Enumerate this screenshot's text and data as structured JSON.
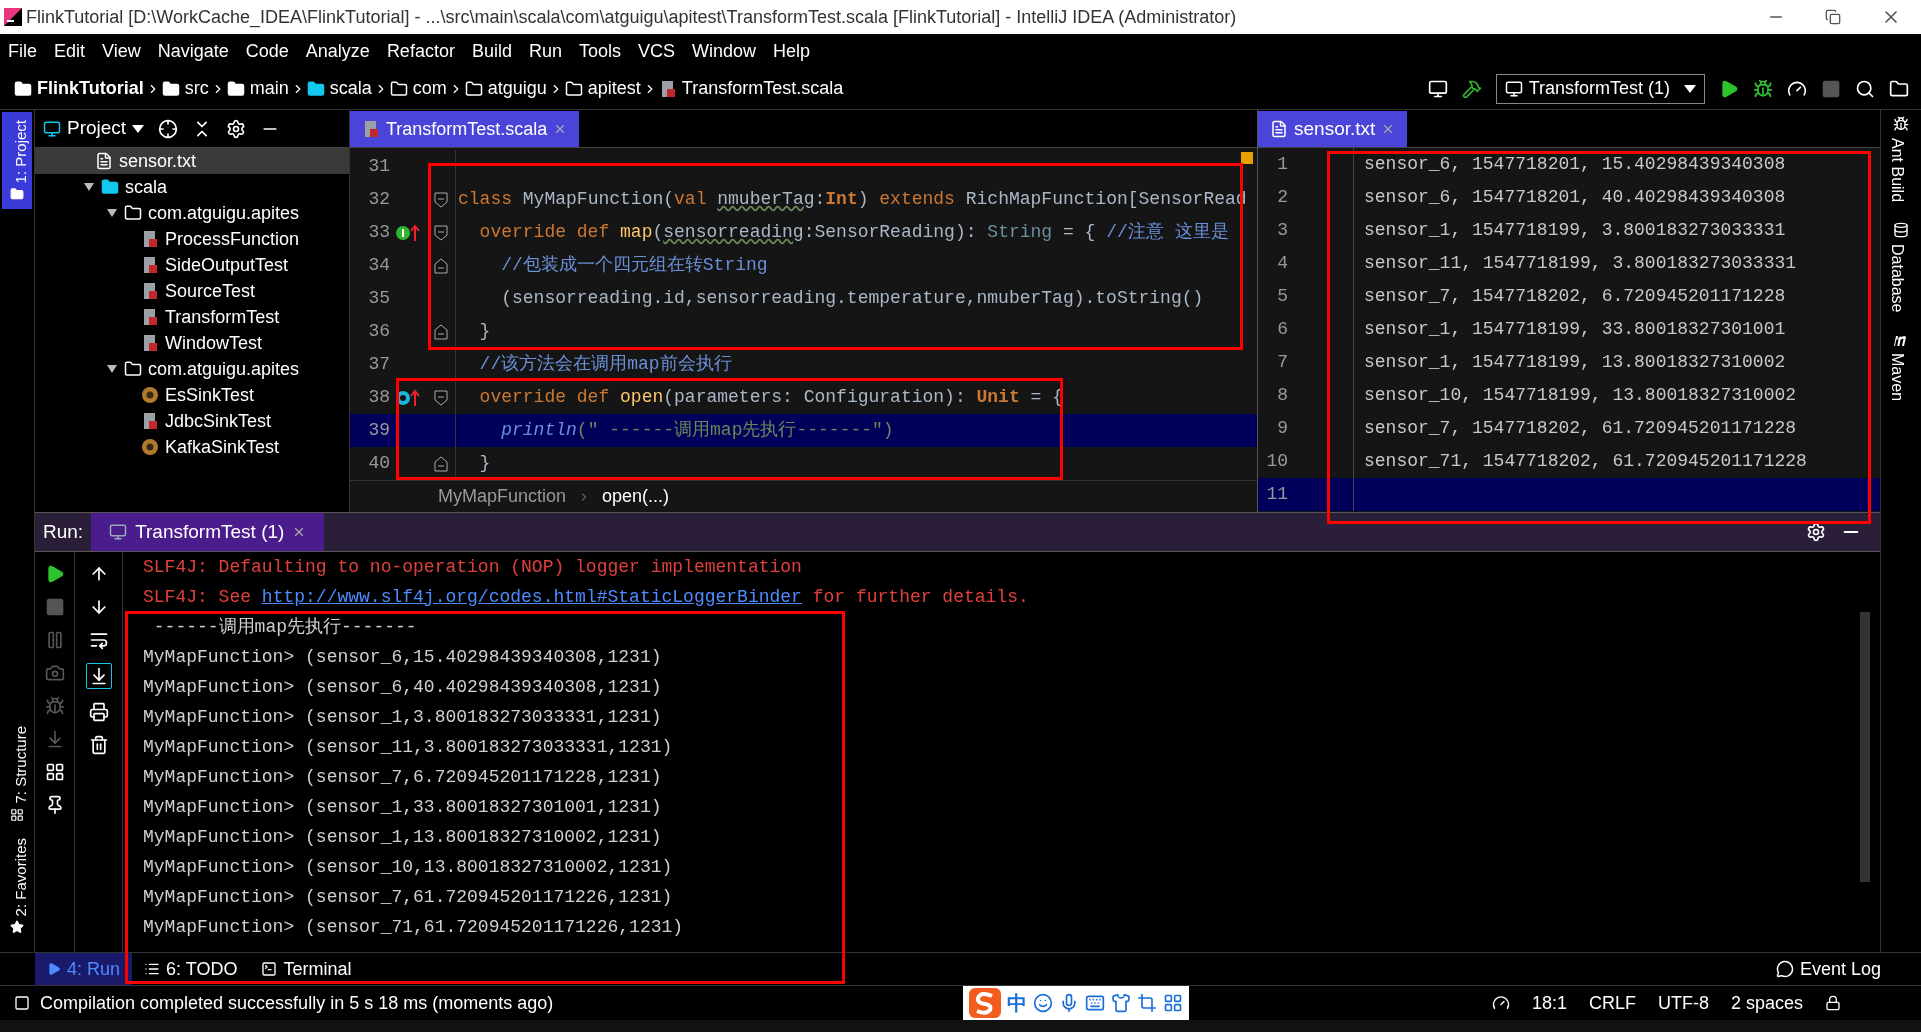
{
  "window": {
    "title": "FlinkTutorial [D:\\WorkCache_IDEA\\FlinkTutorial] - ...\\src\\main\\scala\\com\\atguigu\\apitest\\TransformTest.scala [FlinkTutorial] - IntelliJ IDEA (Administrator)"
  },
  "menu": [
    "File",
    "Edit",
    "View",
    "Navigate",
    "Code",
    "Analyze",
    "Refactor",
    "Build",
    "Run",
    "Tools",
    "VCS",
    "Window",
    "Help"
  ],
  "breadcrumb": [
    {
      "label": "FlinkTutorial",
      "kind": "project"
    },
    {
      "label": "src",
      "kind": "folder"
    },
    {
      "label": "main",
      "kind": "folder"
    },
    {
      "label": "scala",
      "kind": "source"
    },
    {
      "label": "com",
      "kind": "package"
    },
    {
      "label": "atguigu",
      "kind": "package"
    },
    {
      "label": "apitest",
      "kind": "package"
    },
    {
      "label": "TransformTest.scala",
      "kind": "file"
    }
  ],
  "run_config": "TransformTest (1)",
  "left_strip_top": [
    {
      "label": "1: Project",
      "selected": true
    }
  ],
  "left_strip_bottom": [
    {
      "label": "7: Structure",
      "selected": false
    },
    {
      "label": "2: Favorites",
      "selected": false
    }
  ],
  "right_strip": [
    {
      "label": "Ant Build",
      "kind": "ant"
    },
    {
      "label": "Database",
      "kind": "database"
    },
    {
      "label": "Maven",
      "kind": "maven"
    }
  ],
  "project_panel": {
    "title": "Project",
    "tree": [
      {
        "label": "sensor.txt",
        "kind": "text",
        "selected": true
      },
      {
        "label": "scala",
        "kind": "source",
        "selected": false,
        "expanded": true,
        "children": [
          {
            "label": "com.atguigu.apites",
            "kind": "package",
            "selected": false,
            "expanded": true,
            "children": [
              {
                "label": "ProcessFunction",
                "kind": "scala",
                "selected": false
              },
              {
                "label": "SideOutputTest",
                "kind": "scala",
                "selected": false
              },
              {
                "label": "SourceTest",
                "kind": "scala",
                "selected": false
              },
              {
                "label": "TransformTest",
                "kind": "scala",
                "selected": false
              },
              {
                "label": "WindowTest",
                "kind": "scala",
                "selected": false
              }
            ]
          },
          {
            "label": "com.atguigu.apites",
            "kind": "package",
            "selected": false,
            "expanded": true,
            "children": [
              {
                "label": "EsSinkTest",
                "kind": "object",
                "selected": false
              },
              {
                "label": "JdbcSinkTest",
                "kind": "scala",
                "selected": false
              },
              {
                "label": "KafkaSinkTest",
                "kind": "object",
                "selected": false
              }
            ]
          }
        ]
      }
    ]
  },
  "editor": {
    "tab": {
      "label": "TransformTest.scala",
      "selected": true
    },
    "lines": [
      {
        "number": "31",
        "selected": false
      },
      {
        "number": "32",
        "selected": false,
        "fold": {
          "kind": "start"
        },
        "tokens": [
          {
            "text": "class",
            "kind": "keyword"
          },
          {
            "text": " MyMapFunction(",
            "kind": "plain"
          },
          {
            "text": "val ",
            "kind": "keyword"
          },
          {
            "text": "nmuberTag",
            "kind": "underlined"
          },
          {
            "text": ":",
            "kind": "plain"
          },
          {
            "text": "Int",
            "kind": "bold_keyword"
          },
          {
            "text": ") ",
            "kind": "plain"
          },
          {
            "text": "extends",
            "kind": "keyword"
          },
          {
            "text": " RichMapFunction[SensorRead",
            "kind": "plain"
          }
        ]
      },
      {
        "number": "33",
        "selected": false,
        "fold": {
          "kind": "start"
        },
        "marker": {
          "kind": "implements"
        },
        "tokens": [
          {
            "text": "  override def ",
            "kind": "keyword"
          },
          {
            "text": "map",
            "kind": "function"
          },
          {
            "text": "(",
            "kind": "plain"
          },
          {
            "text": "sensorreading",
            "kind": "underlined"
          },
          {
            "text": ":SensorReading): ",
            "kind": "plain"
          },
          {
            "text": "String",
            "kind": "type"
          },
          {
            "text": " = { ",
            "kind": "plain"
          },
          {
            "text": "//注意 这里是",
            "kind": "comment"
          }
        ]
      },
      {
        "number": "34",
        "selected": false,
        "fold": {
          "kind": "end"
        },
        "tokens": [
          {
            "text": "    //包装成一个四元组在转String",
            "kind": "comment"
          }
        ]
      },
      {
        "number": "35",
        "selected": false,
        "tokens": [
          {
            "text": "    (sensorreading.id,sensorreading.temperature,nmuberTag).toString()",
            "kind": "plain"
          }
        ]
      },
      {
        "number": "36",
        "selected": false,
        "fold": {
          "kind": "end"
        },
        "tokens": [
          {
            "text": "  }",
            "kind": "plain"
          }
        ]
      },
      {
        "number": "37",
        "selected": false,
        "tokens": [
          {
            "text": "  //该方法会在调用map前会执行",
            "kind": "comment"
          }
        ]
      },
      {
        "number": "38",
        "selected": false,
        "fold": {
          "kind": "start"
        },
        "marker": {
          "kind": "overridden"
        },
        "tokens": [
          {
            "text": "  override def ",
            "kind": "keyword"
          },
          {
            "text": "open",
            "kind": "function"
          },
          {
            "text": "(parameters: Configuration): ",
            "kind": "plain"
          },
          {
            "text": "Unit",
            "kind": "bold_keyword"
          },
          {
            "text": " = {",
            "kind": "plain"
          }
        ]
      },
      {
        "number": "39",
        "selected": true,
        "tokens": [
          {
            "text": "    println",
            "kind": "italic"
          },
          {
            "text": "(\" ------调用map先执行-------\")",
            "kind": "string"
          }
        ]
      },
      {
        "number": "40",
        "selected": false,
        "fold": {
          "kind": "end"
        },
        "tokens": [
          {
            "text": "  }",
            "kind": "plain"
          }
        ]
      }
    ],
    "breadcrumbs": [
      "MyMapFunction",
      "open(...)"
    ]
  },
  "sensor_editor": {
    "tab": {
      "label": "sensor.txt",
      "selected": true
    },
    "lines": [
      {
        "number": "1",
        "text": "sensor_6, 1547718201, 15.40298439340308",
        "selected": false
      },
      {
        "number": "2",
        "text": "sensor_6, 1547718201, 40.40298439340308",
        "selected": false
      },
      {
        "number": "3",
        "text": "sensor_1, 1547718199, 3.800183273033331",
        "selected": false
      },
      {
        "number": "4",
        "text": "sensor_11, 1547718199, 3.800183273033331",
        "selected": false
      },
      {
        "number": "5",
        "text": "sensor_7, 1547718202, 6.720945201171228",
        "selected": false
      },
      {
        "number": "6",
        "text": "sensor_1, 1547718199, 33.80018327301001",
        "selected": false
      },
      {
        "number": "7",
        "text": "sensor_1, 1547718199, 13.80018327310002",
        "selected": false
      },
      {
        "number": "8",
        "text": "sensor_10, 1547718199, 13.80018327310002",
        "selected": false
      },
      {
        "number": "9",
        "text": "sensor_7, 1547718202, 61.720945201171228",
        "selected": false
      },
      {
        "number": "10",
        "text": "sensor_71, 1547718202, 61.720945201171228",
        "selected": false
      },
      {
        "number": "11",
        "selected": true
      }
    ]
  },
  "run": {
    "label": "Run:",
    "tab": {
      "label": "TransformTest (1)",
      "selected": true
    },
    "console": [
      {
        "kind": "error",
        "text": "SLF4J: Defaulting to no-operation (NOP) logger implementation"
      },
      {
        "kind": "error",
        "text": "SLF4J: See ",
        "link": "http://www.slf4j.org/codes.html#StaticLoggerBinder",
        "after": " for further details."
      },
      {
        "kind": "output",
        "text": " ------调用map先执行-------"
      },
      {
        "kind": "output",
        "text": "MyMapFunction> (sensor_6,15.40298439340308,1231)"
      },
      {
        "kind": "output",
        "text": "MyMapFunction> (sensor_6,40.40298439340308,1231)"
      },
      {
        "kind": "output",
        "text": "MyMapFunction> (sensor_1,3.800183273033331,1231)"
      },
      {
        "kind": "output",
        "text": "MyMapFunction> (sensor_11,3.800183273033331,1231)"
      },
      {
        "kind": "output",
        "text": "MyMapFunction> (sensor_7,6.720945201171228,1231)"
      },
      {
        "kind": "output",
        "text": "MyMapFunction> (sensor_1,33.80018327301001,1231)"
      },
      {
        "kind": "output",
        "text": "MyMapFunction> (sensor_1,13.80018327310002,1231)"
      },
      {
        "kind": "output",
        "text": "MyMapFunction> (sensor_10,13.80018327310002,1231)"
      },
      {
        "kind": "output",
        "text": "MyMapFunction> (sensor_7,61.720945201171226,1231)"
      },
      {
        "kind": "output",
        "text": "MyMapFunction> (sensor_71,61.720945201171226,1231)"
      }
    ]
  },
  "tool_tabs": [
    {
      "label": "4: Run",
      "kind": "run",
      "selected": true
    },
    {
      "label": "6: TODO",
      "kind": "todo",
      "selected": false
    },
    {
      "label": "Terminal",
      "kind": "terminal",
      "selected": false
    }
  ],
  "event_log": "Event Log",
  "ime": "中",
  "status_bar": {
    "message": "Compilation completed successfully in 5 s 18 ms (moments ago)",
    "items": [
      "18:1",
      "CRLF",
      "UTF-8",
      "2 spaces"
    ]
  }
}
